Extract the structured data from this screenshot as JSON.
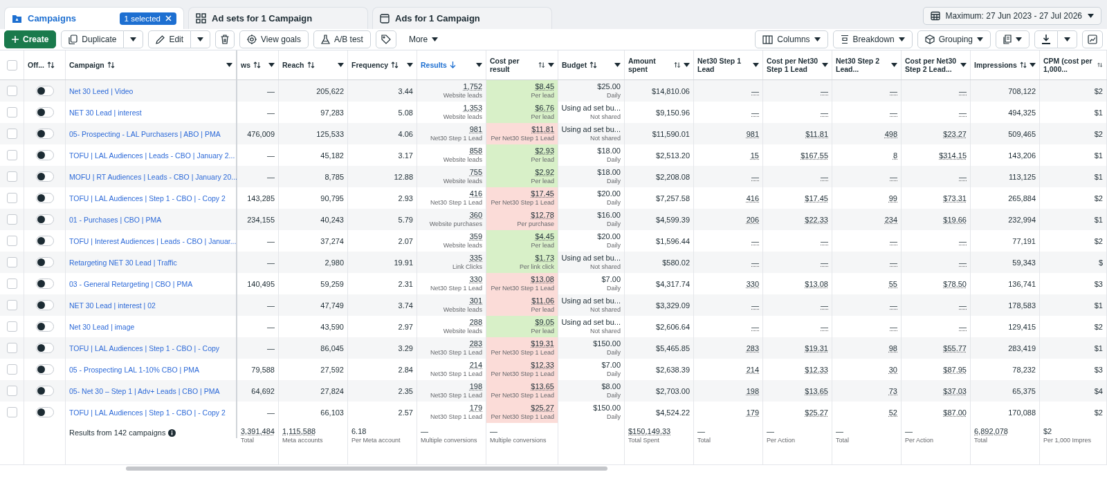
{
  "tabs": [
    {
      "label": "Campaigns",
      "selected": true,
      "badge": "1 selected"
    },
    {
      "label": "Ad sets for 1 Campaign",
      "selected": false
    },
    {
      "label": "Ads for 1 Campaign",
      "selected": false
    }
  ],
  "date_range": "Maximum: 27 Jun 2023 - 27 Jul 2026",
  "toolbar": {
    "create": "Create",
    "duplicate": "Duplicate",
    "edit": "Edit",
    "view_goals": "View goals",
    "ab_test": "A/B test",
    "more": "More",
    "columns": "Columns",
    "breakdown": "Breakdown",
    "grouping": "Grouping"
  },
  "table": {
    "select_all": {
      "checked": false
    },
    "columns": [
      {
        "label": "Off...",
        "kind": "toggle",
        "sortable": true,
        "sorted": false,
        "menu": false
      },
      {
        "label": "Campaign",
        "kind": "name",
        "sortable": true,
        "sorted": false,
        "menu": true
      },
      {
        "label": "ws",
        "kind": "number",
        "sortable": true,
        "sorted": false,
        "menu": true
      },
      {
        "label": "Reach",
        "kind": "number",
        "sortable": true,
        "sorted": false,
        "menu": true
      },
      {
        "label": "Frequency",
        "kind": "number",
        "sortable": true,
        "sorted": false,
        "menu": true
      },
      {
        "label": "Results",
        "kind": "result",
        "sortable": true,
        "sorted": true,
        "menu": true
      },
      {
        "label": "Cost per result",
        "kind": "cost",
        "sortable": true,
        "sorted": false,
        "menu": true
      },
      {
        "label": "Budget",
        "kind": "budget",
        "sortable": true,
        "sorted": false,
        "menu": true
      },
      {
        "label": "Amount spent",
        "kind": "number",
        "sortable": true,
        "sorted": false,
        "menu": true
      },
      {
        "label": "Net30 Step 1 Lead",
        "kind": "link",
        "sortable": false,
        "sorted": false,
        "menu": true
      },
      {
        "label": "Cost per Net30 Step 1 Lead",
        "kind": "link",
        "sortable": false,
        "sorted": false,
        "menu": true
      },
      {
        "label": "Net30 Step 2 Lead...",
        "kind": "link",
        "sortable": false,
        "sorted": false,
        "menu": true
      },
      {
        "label": "Cost per Net30 Step 2 Lead...",
        "kind": "link",
        "sortable": false,
        "sorted": false,
        "menu": true
      },
      {
        "label": "Impressions",
        "kind": "number",
        "sortable": true,
        "sorted": false,
        "menu": true
      },
      {
        "label": "CPM (cost per 1,000...",
        "kind": "number",
        "sortable": true,
        "sorted": false,
        "menu": false
      }
    ],
    "rows": [
      {
        "checked": false,
        "on": false,
        "campaign": "Net 30 Leed | Video",
        "values": [
          "—",
          "205,622",
          "3.44",
          {
            "value": "1,752",
            "sub": "Website leads"
          },
          {
            "value": "$8.45",
            "sub": "Per lead",
            "color": "#d8f0c8"
          },
          {
            "value": "$25.00",
            "sub": "Daily"
          },
          "$14,810.06",
          "—",
          "—",
          "—",
          "—",
          "708,122",
          "$2"
        ]
      },
      {
        "checked": false,
        "on": false,
        "campaign": "NET 30 Lead | interest",
        "values": [
          "—",
          "97,283",
          "5.08",
          {
            "value": "1,353",
            "sub": "Website leads"
          },
          {
            "value": "$6.76",
            "sub": "Per lead",
            "color": "#d8f0c8"
          },
          {
            "value": "Using ad set bu...",
            "sub": "Not shared"
          },
          "$9,150.96",
          "—",
          "—",
          "—",
          "—",
          "494,325",
          "$1"
        ]
      },
      {
        "checked": false,
        "on": false,
        "campaign": "05- Prospecting - LAL Purchasers | ABO | PMA",
        "values": [
          "476,009",
          "125,533",
          "4.06",
          {
            "value": "981",
            "sub": "Net30 Step 1 Lead"
          },
          {
            "value": "$11.81",
            "sub": "Per Net30 Step 1 Lead",
            "color": "#fbdcd8"
          },
          {
            "value": "Using ad set bu...",
            "sub": "Not shared"
          },
          "$11,590.01",
          "981",
          "$11.81",
          "498",
          "$23.27",
          "509,465",
          "$2"
        ]
      },
      {
        "checked": false,
        "on": false,
        "campaign": "TOFU | LAL Audiences | Leads - CBO | January 2...",
        "values": [
          "—",
          "45,182",
          "3.17",
          {
            "value": "858",
            "sub": "Website leads"
          },
          {
            "value": "$2.93",
            "sub": "Per lead",
            "color": "#d8f0c8"
          },
          {
            "value": "$18.00",
            "sub": "Daily"
          },
          "$2,513.20",
          "15",
          "$167.55",
          "8",
          "$314.15",
          "143,206",
          "$1"
        ]
      },
      {
        "checked": false,
        "on": false,
        "campaign": "MOFU | RT Audiences | Leads - CBO | January 20...",
        "values": [
          "—",
          "8,785",
          "12.88",
          {
            "value": "755",
            "sub": "Website leads"
          },
          {
            "value": "$2.92",
            "sub": "Per lead",
            "color": "#d8f0c8"
          },
          {
            "value": "$18.00",
            "sub": "Daily"
          },
          "$2,208.08",
          "—",
          "—",
          "—",
          "—",
          "113,125",
          "$1"
        ]
      },
      {
        "checked": false,
        "on": false,
        "campaign": "TOFU | LAL Audiences | Step 1 - CBO | - Copy 2",
        "values": [
          "143,285",
          "90,795",
          "2.93",
          {
            "value": "416",
            "sub": "Net30 Step 1 Lead"
          },
          {
            "value": "$17.45",
            "sub": "Per Net30 Step 1 Lead",
            "color": "#fbdcd8"
          },
          {
            "value": "$20.00",
            "sub": "Daily"
          },
          "$7,257.58",
          "416",
          "$17.45",
          "99",
          "$73.31",
          "265,884",
          "$2"
        ]
      },
      {
        "checked": false,
        "on": false,
        "campaign": "01 - Purchases | CBO | PMA",
        "values": [
          "234,155",
          "40,243",
          "5.79",
          {
            "value": "360",
            "sub": "Website purchases"
          },
          {
            "value": "$12.78",
            "sub": "Per purchase",
            "color": "#fbdcd8"
          },
          {
            "value": "$16.00",
            "sub": "Daily"
          },
          "$4,599.39",
          "206",
          "$22.33",
          "234",
          "$19.66",
          "232,994",
          "$1"
        ]
      },
      {
        "checked": false,
        "on": false,
        "campaign": "TOFU | Interest Audiences | Leads - CBO | Januar...",
        "values": [
          "—",
          "37,274",
          "2.07",
          {
            "value": "359",
            "sub": "Website leads"
          },
          {
            "value": "$4.45",
            "sub": "Per lead",
            "color": "#d8f0c8"
          },
          {
            "value": "$20.00",
            "sub": "Daily"
          },
          "$1,596.44",
          "—",
          "—",
          "—",
          "—",
          "77,191",
          "$2"
        ]
      },
      {
        "checked": false,
        "on": false,
        "campaign": "Retargeting NET 30 Lead | Traffic",
        "values": [
          "—",
          "2,980",
          "19.91",
          {
            "value": "335",
            "sub": "Link Clicks"
          },
          {
            "value": "$1.73",
            "sub": "Per link click",
            "color": "#d8f0c8"
          },
          {
            "value": "Using ad set bu...",
            "sub": "Not shared"
          },
          "$580.02",
          "—",
          "—",
          "—",
          "—",
          "59,343",
          "$"
        ]
      },
      {
        "checked": false,
        "on": false,
        "campaign": "03 - General Retargeting | CBO | PMA",
        "values": [
          "140,495",
          "59,259",
          "2.31",
          {
            "value": "330",
            "sub": "Net30 Step 1 Lead"
          },
          {
            "value": "$13.08",
            "sub": "Per Net30 Step 1 Lead",
            "color": "#fbdcd8"
          },
          {
            "value": "$7.00",
            "sub": "Daily"
          },
          "$4,317.74",
          "330",
          "$13.08",
          "55",
          "$78.50",
          "136,741",
          "$3"
        ]
      },
      {
        "checked": false,
        "on": false,
        "campaign": "NET 30 Lead | interest | 02",
        "values": [
          "—",
          "47,749",
          "3.74",
          {
            "value": "301",
            "sub": "Website leads"
          },
          {
            "value": "$11.06",
            "sub": "Per lead",
            "color": "#fbdcd8"
          },
          {
            "value": "Using ad set bu...",
            "sub": "Not shared"
          },
          "$3,329.09",
          "—",
          "—",
          "—",
          "—",
          "178,583",
          "$1"
        ]
      },
      {
        "checked": false,
        "on": false,
        "campaign": "Net 30 Lead | image",
        "values": [
          "—",
          "43,590",
          "2.97",
          {
            "value": "288",
            "sub": "Website leads"
          },
          {
            "value": "$9.05",
            "sub": "Per lead",
            "color": "#d8f0c8"
          },
          {
            "value": "Using ad set bu...",
            "sub": "Not shared"
          },
          "$2,606.64",
          "—",
          "—",
          "—",
          "—",
          "129,415",
          "$2"
        ]
      },
      {
        "checked": false,
        "on": false,
        "campaign": "TOFU | LAL Audiences | Step 1 - CBO | - Copy",
        "values": [
          "—",
          "86,045",
          "3.29",
          {
            "value": "283",
            "sub": "Net30 Step 1 Lead"
          },
          {
            "value": "$19.31",
            "sub": "Per Net30 Step 1 Lead",
            "color": "#fbdcd8"
          },
          {
            "value": "$150.00",
            "sub": "Daily"
          },
          "$5,465.85",
          "283",
          "$19.31",
          "98",
          "$55.77",
          "283,419",
          "$1"
        ]
      },
      {
        "checked": false,
        "on": false,
        "campaign": "05 - Prospecting LAL 1-10% CBO | PMA",
        "values": [
          "79,588",
          "27,592",
          "2.84",
          {
            "value": "214",
            "sub": "Net30 Step 1 Lead"
          },
          {
            "value": "$12.33",
            "sub": "Per Net30 Step 1 Lead",
            "color": "#fbdcd8"
          },
          {
            "value": "$7.00",
            "sub": "Daily"
          },
          "$2,638.39",
          "214",
          "$12.33",
          "30",
          "$87.95",
          "78,232",
          "$3"
        ]
      },
      {
        "checked": false,
        "on": false,
        "campaign": "05- Net 30 – Step 1 | Adv+ Leads | CBO | PMA",
        "values": [
          "64,692",
          "27,824",
          "2.35",
          {
            "value": "198",
            "sub": "Net30 Step 1 Lead"
          },
          {
            "value": "$13.65",
            "sub": "Per Net30 Step 1 Lead",
            "color": "#fbdcd8"
          },
          {
            "value": "$8.00",
            "sub": "Daily"
          },
          "$2,703.00",
          "198",
          "$13.65",
          "73",
          "$37.03",
          "65,375",
          "$4"
        ]
      },
      {
        "checked": false,
        "on": false,
        "campaign": "TOFU | LAL Audiences | Step 1 - CBO | - Copy 2",
        "values": [
          "—",
          "66,103",
          "2.57",
          {
            "value": "179",
            "sub": "Net30 Step 1 Lead"
          },
          {
            "value": "$25.27",
            "sub": "Per Net30 Step 1 Lead",
            "color": "#fbdcd8"
          },
          {
            "value": "$150.00",
            "sub": "Daily"
          },
          "$4,524.22",
          "179",
          "$25.27",
          "52",
          "$87.00",
          "170,088",
          "$2"
        ]
      }
    ],
    "footer": {
      "label": "Results from 142 campaigns",
      "values": [
        {
          "value": "3,391,484",
          "sub": "Total"
        },
        {
          "value": "1,115,588",
          "sub": "Meta accounts"
        },
        {
          "value": "6.18",
          "sub": "Per Meta account"
        },
        {
          "value": "—",
          "sub": "Multiple conversions"
        },
        {
          "value": "—",
          "sub": "Multiple conversions"
        },
        {
          "value": "$150,149.33",
          "sub": "Total Spent"
        },
        {
          "value": "—",
          "sub": "Total"
        },
        {
          "value": "—",
          "sub": "Per Action"
        },
        {
          "value": "—",
          "sub": "Total"
        },
        {
          "value": "—",
          "sub": "Per Action"
        },
        {
          "value": "6,892,078",
          "sub": "Total"
        },
        {
          "value": "$2",
          "sub": "Per 1,000 Impres"
        }
      ]
    }
  }
}
